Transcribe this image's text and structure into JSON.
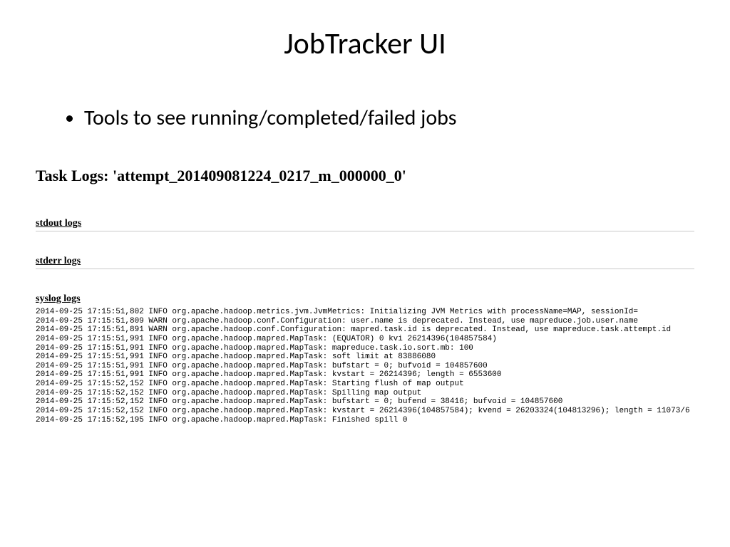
{
  "slide": {
    "title": "JobTracker UI",
    "bullets": [
      "Tools to see running/completed/failed jobs"
    ]
  },
  "taskLogs": {
    "heading": "Task Logs: 'attempt_201409081224_0217_m_000000_0'",
    "sections": {
      "stdout": {
        "label": "stdout logs"
      },
      "stderr": {
        "label": "stderr logs"
      },
      "syslog": {
        "label": "syslog logs",
        "lines": [
          "2014-09-25 17:15:51,802 INFO org.apache.hadoop.metrics.jvm.JvmMetrics: Initializing JVM Metrics with processName=MAP, sessionId=",
          "2014-09-25 17:15:51,809 WARN org.apache.hadoop.conf.Configuration: user.name is deprecated. Instead, use mapreduce.job.user.name",
          "2014-09-25 17:15:51,891 WARN org.apache.hadoop.conf.Configuration: mapred.task.id is deprecated. Instead, use mapreduce.task.attempt.id",
          "2014-09-25 17:15:51,991 INFO org.apache.hadoop.mapred.MapTask: (EQUATOR) 0 kvi 26214396(104857584)",
          "2014-09-25 17:15:51,991 INFO org.apache.hadoop.mapred.MapTask: mapreduce.task.io.sort.mb: 100",
          "2014-09-25 17:15:51,991 INFO org.apache.hadoop.mapred.MapTask: soft limit at 83886080",
          "2014-09-25 17:15:51,991 INFO org.apache.hadoop.mapred.MapTask: bufstart = 0; bufvoid = 104857600",
          "2014-09-25 17:15:51,991 INFO org.apache.hadoop.mapred.MapTask: kvstart = 26214396; length = 6553600",
          "2014-09-25 17:15:52,152 INFO org.apache.hadoop.mapred.MapTask: Starting flush of map output",
          "2014-09-25 17:15:52,152 INFO org.apache.hadoop.mapred.MapTask: Spilling map output",
          "2014-09-25 17:15:52,152 INFO org.apache.hadoop.mapred.MapTask: bufstart = 0; bufend = 38416; bufvoid = 104857600",
          "2014-09-25 17:15:52,152 INFO org.apache.hadoop.mapred.MapTask: kvstart = 26214396(104857584); kvend = 26203324(104813296); length = 11073/6",
          "2014-09-25 17:15:52,195 INFO org.apache.hadoop.mapred.MapTask: Finished spill 0"
        ]
      }
    }
  }
}
